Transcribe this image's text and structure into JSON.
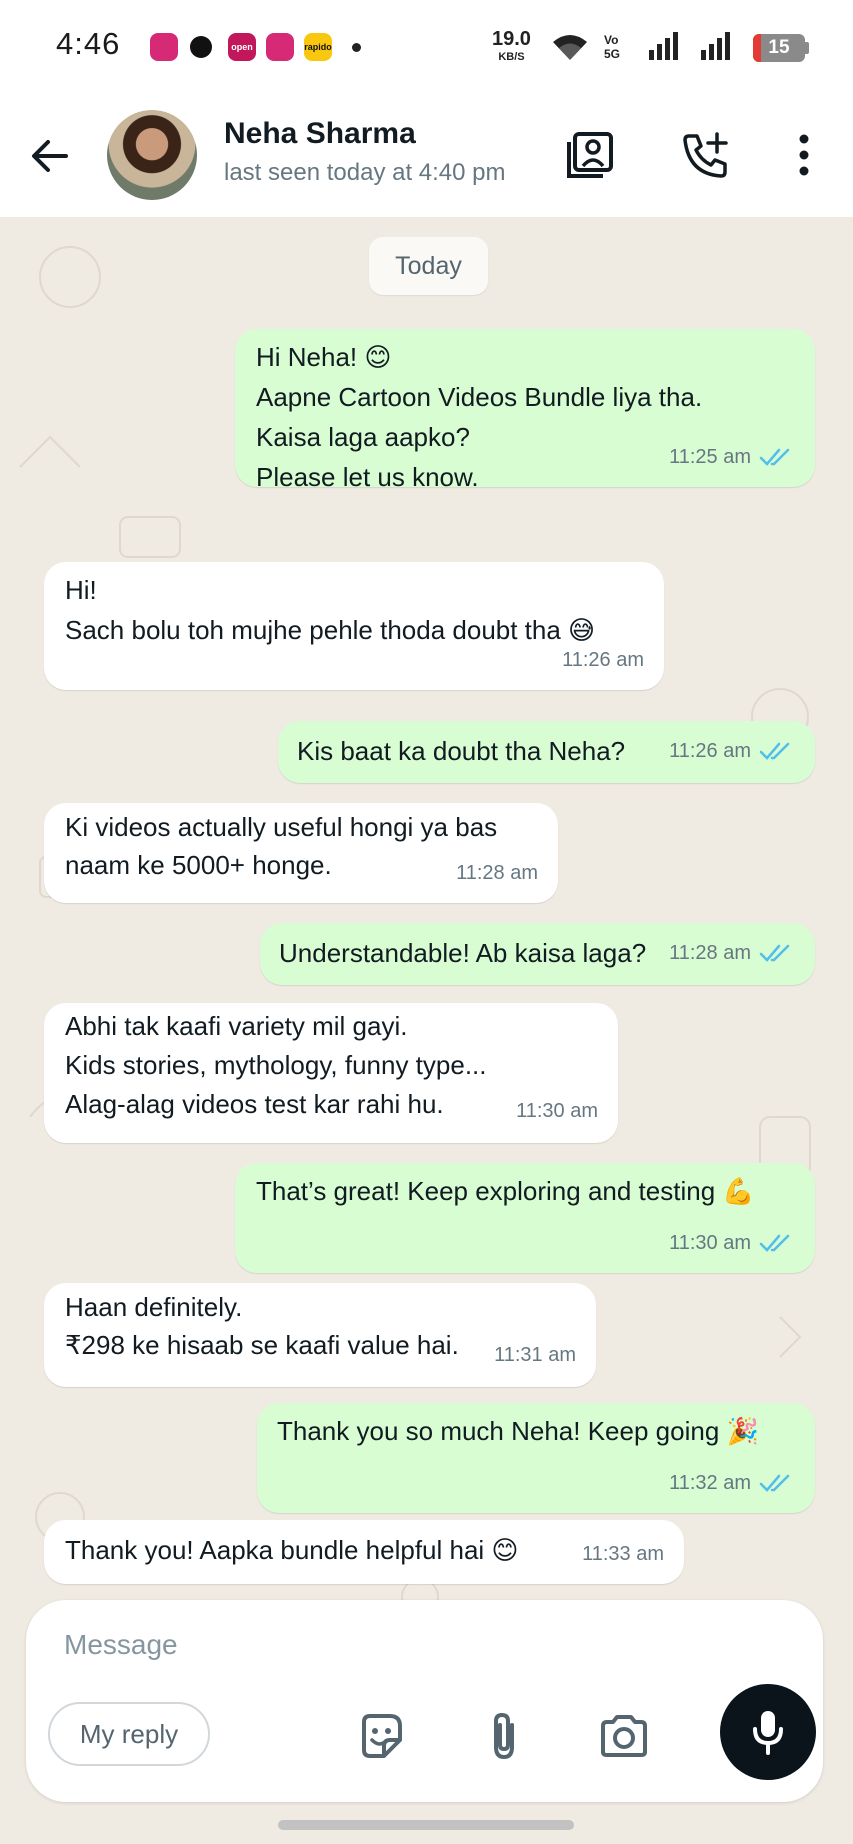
{
  "status_bar": {
    "time": "4:46",
    "notif_icons": [
      {
        "name": "instagram-icon",
        "label": "",
        "color": "#d62976"
      },
      {
        "name": "threads-icon",
        "label": "",
        "color": "#111111"
      },
      {
        "name": "open-app-icon",
        "label": "open",
        "color": "#c2185b"
      },
      {
        "name": "instagram-icon",
        "label": "",
        "color": "#d62976"
      },
      {
        "name": "rapido-icon",
        "label": "rapido",
        "color": "#f9c80e"
      }
    ],
    "speed_value": "19.0",
    "speed_unit": "KB/S",
    "volte_label": "Vo 5G",
    "battery_level": "15",
    "battery_fraction": 0.15
  },
  "header": {
    "contact_name": "Neha Sharma",
    "status": "last seen today at 4:40 pm"
  },
  "chat": {
    "date_label": "Today",
    "messages": [
      {
        "dir": "out",
        "text": "Hi Neha! 😊\nAapne Cartoon Videos Bundle liya tha.\nKaisa laga aapko?\nPlease let us know.",
        "time": "11:25 am",
        "read": true
      },
      {
        "dir": "in",
        "text": "Hi!\nSach bolu toh mujhe pehle thoda doubt tha 😅",
        "time": "11:26 am"
      },
      {
        "dir": "out",
        "text": "Kis baat ka doubt tha Neha?",
        "time": "11:26 am",
        "read": true
      },
      {
        "dir": "in",
        "text": "Ki videos actually useful hongi ya bas\nnaam ke 5000+ honge.",
        "time": "11:28 am"
      },
      {
        "dir": "out",
        "text": "Understandable! Ab kaisa laga?",
        "time": "11:28 am",
        "read": true
      },
      {
        "dir": "in",
        "text": "Abhi tak kaafi variety mil gayi.\nKids stories, mythology, funny type...\nAlag-alag videos test kar rahi hu.",
        "time": "11:30 am"
      },
      {
        "dir": "out",
        "text": "That’s great! Keep exploring and testing 💪",
        "time": "11:30 am",
        "read": true
      },
      {
        "dir": "in",
        "text": "Haan definitely.\n₹298 ke hisaab se kaafi value hai.",
        "time": "11:31 am"
      },
      {
        "dir": "out",
        "text": "Thank you so much Neha! Keep going 🎉",
        "time": "11:32 am",
        "read": true
      },
      {
        "dir": "in",
        "text": "Thank you! Aapka bundle helpful hai 😊",
        "time": "11:33 am"
      }
    ]
  },
  "composer": {
    "placeholder": "Message",
    "reply_chip": "My reply"
  },
  "colors": {
    "outgoing_bubble": "#d9fdd3",
    "incoming_bubble": "#ffffff",
    "read_tick": "#53bdeb",
    "wallpaper": "#efeae2"
  }
}
